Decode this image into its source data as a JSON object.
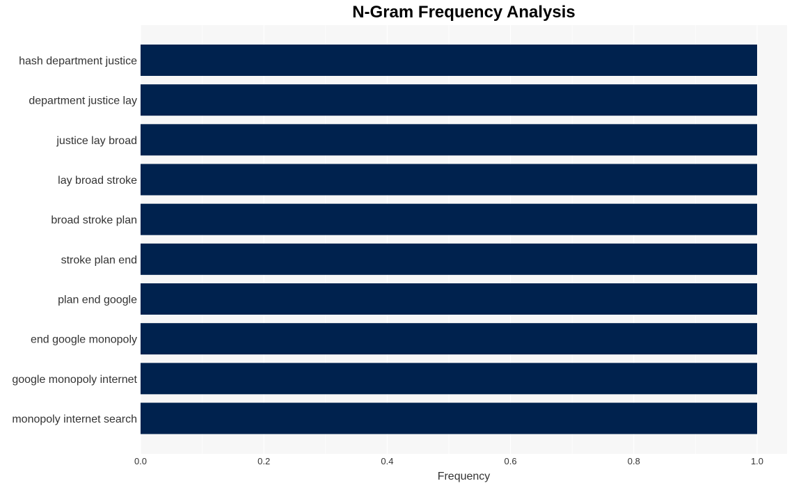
{
  "chart_data": {
    "type": "bar",
    "orientation": "horizontal",
    "title": "N-Gram Frequency Analysis",
    "xlabel": "Frequency",
    "ylabel": "",
    "categories": [
      "hash department justice",
      "department justice lay",
      "justice lay broad",
      "lay broad stroke",
      "broad stroke plan",
      "stroke plan end",
      "plan end google",
      "end google monopoly",
      "google monopoly internet",
      "monopoly internet search"
    ],
    "values": [
      1,
      1,
      1,
      1,
      1,
      1,
      1,
      1,
      1,
      1
    ],
    "xlim": [
      0,
      1.05
    ],
    "xticks": [
      0.0,
      0.2,
      0.4,
      0.6,
      0.8,
      1.0
    ],
    "xtick_labels": [
      "0.0",
      "0.2",
      "0.4",
      "0.6",
      "0.8",
      "1.0"
    ],
    "grid": true,
    "legend": "none",
    "colors": {
      "bar": "#00224e",
      "plot_background": "#f7f7f7",
      "grid": "#ffffff"
    }
  }
}
